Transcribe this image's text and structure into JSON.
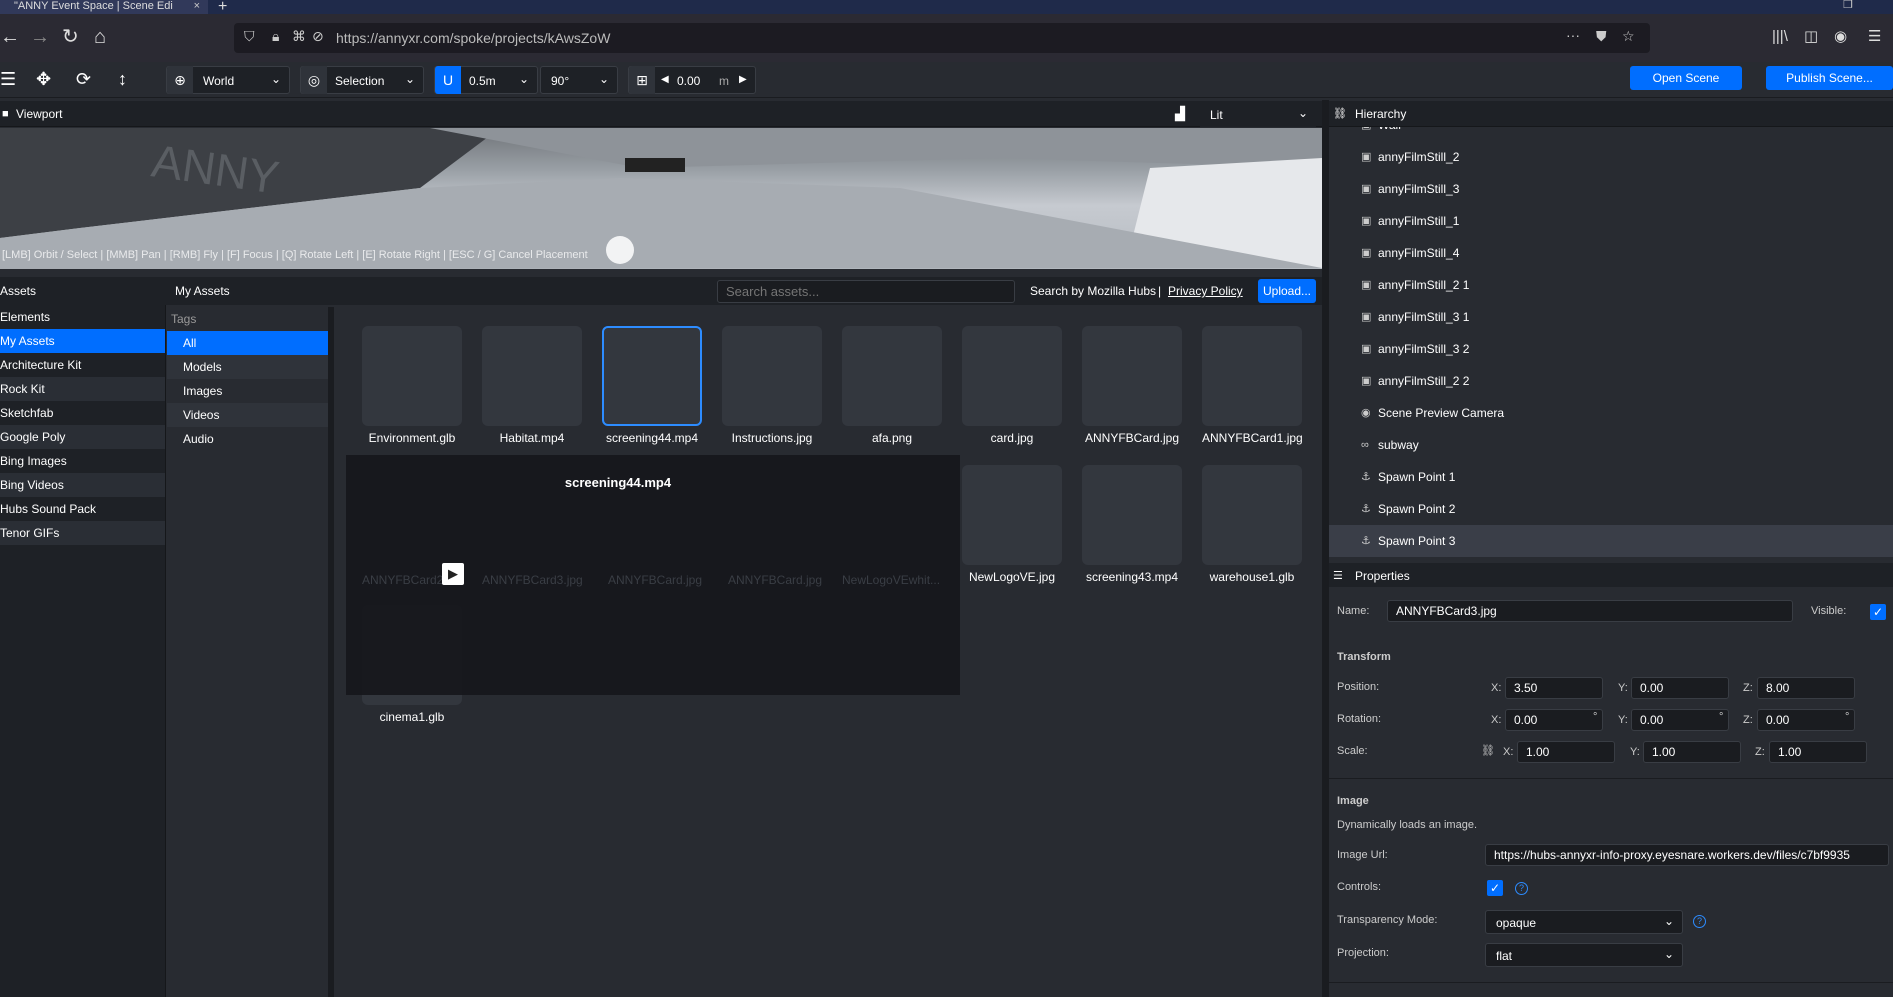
{
  "browser": {
    "tab_title": "\"ANNY Event Space | Scene Edi",
    "tab_close": "×",
    "new_tab": "+",
    "url": "https://annyxr.com/spoke/projects/kAwsZoW",
    "back": "←",
    "forward": "→",
    "reload": "↻",
    "home": "⌂",
    "more": "···"
  },
  "toolbar": {
    "space_value": "World",
    "select_mode": "Selection",
    "snap_value": "0.5m",
    "rotation_snap": "90°",
    "grid_value": "0.00",
    "grid_unit": "m",
    "open_scene": "Open Scene",
    "publish_scene": "Publish Scene..."
  },
  "viewport": {
    "title": "Viewport",
    "hint": "[LMB] Orbit / Select | [MMB] Pan | [RMB] Fly | [F] Focus | [Q] Rotate Left | [E] Rotate Right | [ESC / G] Cancel Placement",
    "render_mode": "Lit"
  },
  "assets": {
    "title": "Assets",
    "my_assets_title": "My Assets",
    "search_placeholder": "Search assets...",
    "search_by": "Search by Mozilla Hubs",
    "separator": "|",
    "privacy": "Privacy Policy",
    "upload": "Upload...",
    "tags_label": "Tags",
    "sources": [
      "Elements",
      "My Assets",
      "Architecture Kit",
      "Rock Kit",
      "Sketchfab",
      "Google Poly",
      "Bing Images",
      "Bing Videos",
      "Hubs Sound Pack",
      "Tenor GIFs"
    ],
    "tags": [
      "All",
      "Models",
      "Images",
      "Videos",
      "Audio"
    ],
    "items": [
      "Environment.glb",
      "Habitat.mp4",
      "screening44.mp4",
      "Instructions.jpg",
      "afa.png",
      "card.jpg",
      "ANNYFBCard.jpg",
      "ANNYFBCard1.jpg",
      "NewLogoVE.jpg",
      "screening43.mp4",
      "warehouse1.glb",
      "cinema1.glb"
    ],
    "drag_title": "screening44.mp4",
    "ghost_items": [
      "ANNYFBCard2",
      "ANNYFBCard3.jpg",
      "ANNYFBCard.jpg",
      "ANNYFBCard.jpg",
      "NewLogoVEwhit..."
    ]
  },
  "hierarchy": {
    "title": "Hierarchy",
    "items": [
      {
        "label": "Wall",
        "icon": "▣"
      },
      {
        "label": "annyFilmStill_2",
        "icon": "▣"
      },
      {
        "label": "annyFilmStill_3",
        "icon": "▣"
      },
      {
        "label": "annyFilmStill_1",
        "icon": "▣"
      },
      {
        "label": "annyFilmStill_4",
        "icon": "▣"
      },
      {
        "label": "annyFilmStill_2 1",
        "icon": "▣"
      },
      {
        "label": "annyFilmStill_3 1",
        "icon": "▣"
      },
      {
        "label": "annyFilmStill_3 2",
        "icon": "▣"
      },
      {
        "label": "annyFilmStill_2 2",
        "icon": "▣"
      },
      {
        "label": "Scene Preview Camera",
        "icon": "◉"
      },
      {
        "label": "subway",
        "icon": "∞"
      },
      {
        "label": "Spawn Point 1",
        "icon": "⚓"
      },
      {
        "label": "Spawn Point 2",
        "icon": "⚓"
      },
      {
        "label": "Spawn Point 3",
        "icon": "⚓"
      }
    ]
  },
  "properties": {
    "title": "Properties",
    "name_label": "Name:",
    "name_value": "ANNYFBCard3.jpg",
    "visible_label": "Visible:",
    "transform_label": "Transform",
    "position_label": "Position:",
    "rotation_label": "Rotation:",
    "scale_label": "Scale:",
    "axis_x": "X:",
    "axis_y": "Y:",
    "axis_z": "Z:",
    "position": {
      "x": "3.50",
      "y": "0.00",
      "z": "8.00"
    },
    "rotation": {
      "x": "0.00",
      "y": "0.00",
      "z": "0.00"
    },
    "rotation_unit": "°",
    "scale": {
      "x": "1.00",
      "y": "1.00",
      "z": "1.00"
    },
    "image_label": "Image",
    "image_desc": "Dynamically loads an image.",
    "image_url_label": "Image Url:",
    "image_url": "https://hubs-annyxr-info-proxy.eyesnare.workers.dev/files/c7bf9935",
    "controls_label": "Controls:",
    "transparency_label": "Transparency Mode:",
    "transparency_value": "opaque",
    "projection_label": "Projection:",
    "projection_value": "flat",
    "check": "✓",
    "help": "?"
  }
}
